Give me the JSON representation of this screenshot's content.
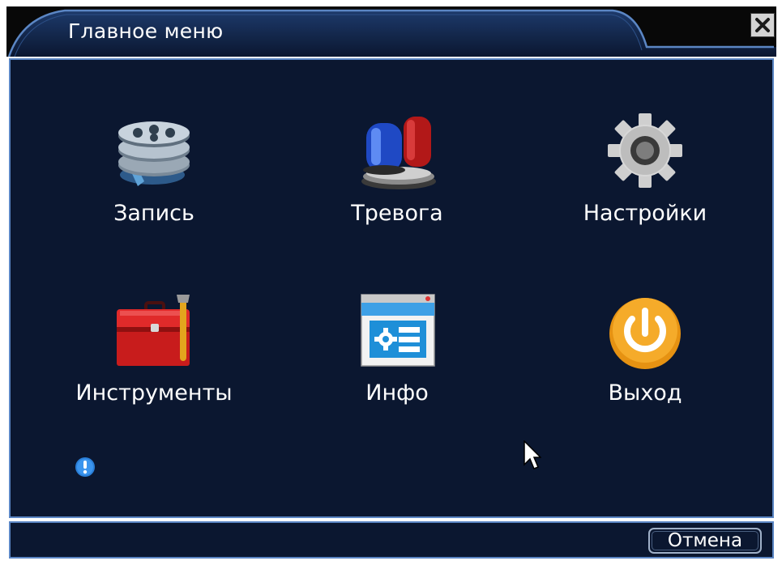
{
  "window": {
    "title": "Главное меню",
    "accent_color": "#5b86c4",
    "background_color": "#0b1730"
  },
  "menu": {
    "items": [
      {
        "label": "Запись",
        "icon": "film-reels-icon"
      },
      {
        "label": "Тревога",
        "icon": "alarm-siren-icon"
      },
      {
        "label": "Настройки",
        "icon": "gear-icon"
      },
      {
        "label": "Инструменты",
        "icon": "toolbox-icon"
      },
      {
        "label": "Инфо",
        "icon": "info-window-icon"
      },
      {
        "label": "Выход",
        "icon": "power-icon"
      }
    ]
  },
  "status": {
    "icon": "exclamation-icon"
  },
  "footer": {
    "cancel_label": "Отмена"
  }
}
